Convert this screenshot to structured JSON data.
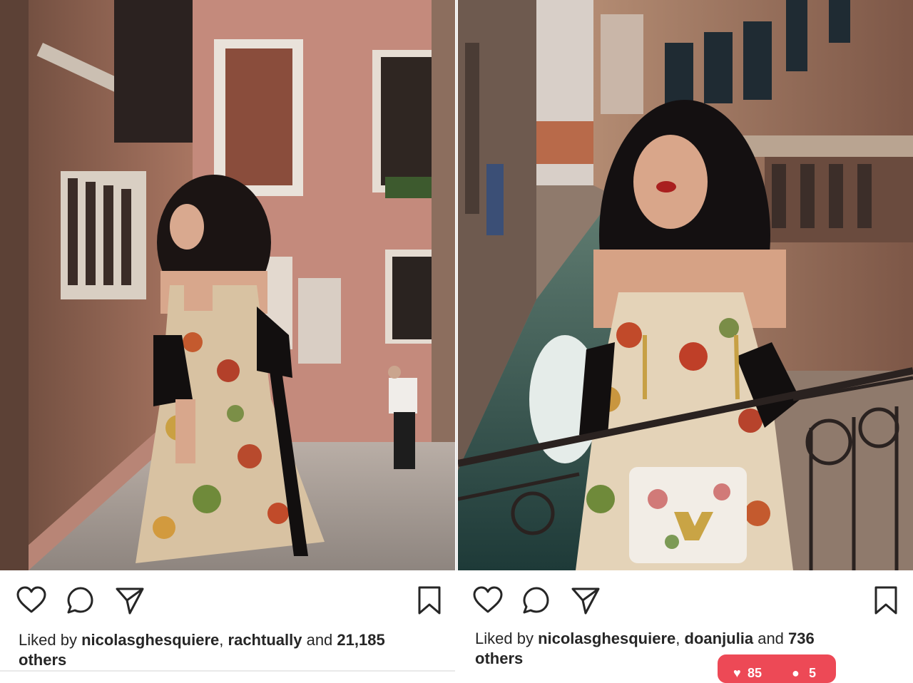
{
  "posts": [
    {
      "liked_by_prefix": "Liked by",
      "user1": "nicolasghesquiere",
      "sep": ",",
      "user2": "rachtually",
      "and": "and",
      "count": "21,185",
      "others": "others"
    },
    {
      "liked_by_prefix": "Liked by",
      "user1": "nicolasghesquiere",
      "sep": ",",
      "user2": "doanjulia",
      "and": "and",
      "count": "736",
      "others": "others"
    }
  ],
  "notification": {
    "likes": "85",
    "comments": "5"
  },
  "icons": [
    "heart-icon",
    "comment-icon",
    "share-icon",
    "bookmark-icon"
  ],
  "colors": {
    "text": "#262626",
    "notif": "#ed4956"
  }
}
